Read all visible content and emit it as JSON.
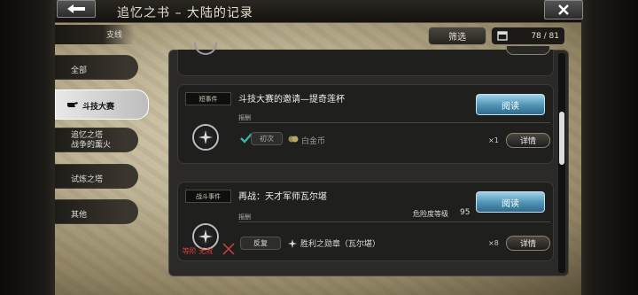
{
  "header": {
    "title": "追忆之书 – 大陆的记录",
    "back_icon": "arrow-left-icon",
    "close_icon": "close-x-icon"
  },
  "branch_label": "支线",
  "toolbar": {
    "filter_label": "筛选",
    "count": "78 / 81"
  },
  "sidebar": {
    "items": [
      {
        "label": "全部",
        "active": false
      },
      {
        "label": "斗技大赛",
        "active": true
      },
      {
        "label": "追忆之塔\n战争的薰火",
        "active": false
      },
      {
        "label": "试炼之塔",
        "active": false
      },
      {
        "label": "其他",
        "active": false
      }
    ]
  },
  "events": [
    {
      "badge": "短事件",
      "title": "斗技大赛的邀请—提奇莲杯",
      "reward_label": "报酬",
      "read_label": "阅读",
      "chip": "初次",
      "reward_name": "白金币",
      "qty": "×1",
      "detail_label": "详情"
    },
    {
      "badge": "战斗事件",
      "title": "再战：天才军师瓦尔堪",
      "reward_label": "报酬",
      "danger_label": "危险度等级",
      "danger_value": "95",
      "read_label": "阅读",
      "chip": "反复",
      "reward_name": "胜利之勋章（瓦尔堪）",
      "qty": "×8",
      "detail_label": "详情",
      "invalid_label": "等阶 无效"
    }
  ],
  "colors": {
    "read_button": "#4e93b4",
    "invalid_text": "#e0403a",
    "check_mark": "#39b3a8"
  }
}
